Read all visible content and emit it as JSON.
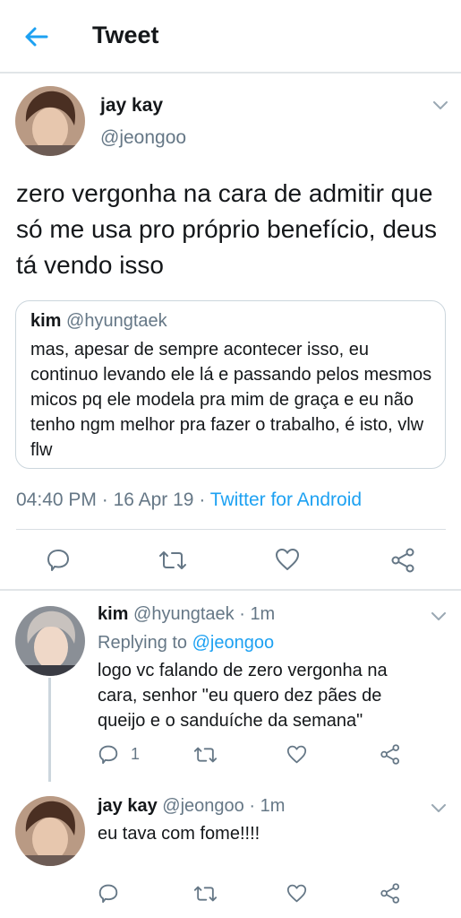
{
  "header": {
    "title": "Tweet",
    "back_icon": "arrow-left-icon",
    "accent_color": "#1da1f2"
  },
  "main_tweet": {
    "name": "jay kay",
    "handle": "@jeongoo",
    "text": "zero vergonha na cara de admitir que só me usa pro próprio benefício, deus tá vendo isso",
    "quoted": {
      "name": "kim",
      "handle": "@hyungtaek",
      "text": "mas, apesar de sempre acontecer isso, eu continuo levando ele lá e passando pelos mesmos micos pq ele modela pra mim de graça e eu não tenho ngm melhor pra fazer o trabalho, é isto, vlw flw"
    },
    "time": "04:40 PM",
    "separator": "·",
    "date": "16 Apr 19",
    "source": "Twitter for Android"
  },
  "replies": [
    {
      "name": "kim",
      "handle": "@hyungtaek",
      "separator": "·",
      "time_ago": "1m",
      "replying_to_label": "Replying to",
      "replying_to_handle": "@jeongoo",
      "text": "logo vc falando de zero vergonha na cara, senhor \"eu quero dez pães de queijo e o sanduíche da semana\"",
      "reply_count": "1"
    },
    {
      "name": "jay kay",
      "handle": "@jeongoo",
      "separator": "·",
      "time_ago": "1m",
      "text": "eu tava com fome!!!!",
      "reply_count": ""
    }
  ],
  "actions": [
    "reply-icon",
    "retweet-icon",
    "like-icon",
    "share-icon"
  ]
}
